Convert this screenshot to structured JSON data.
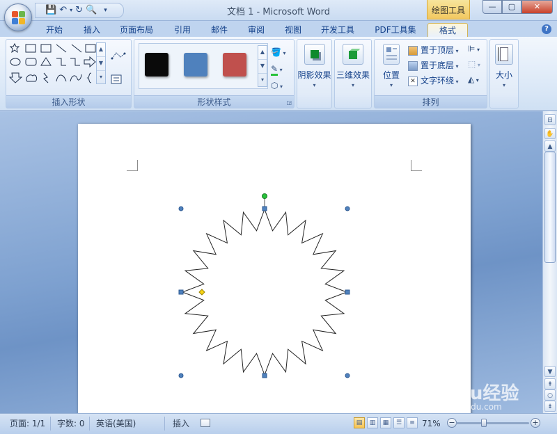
{
  "window": {
    "title": "文档 1 - Microsoft Word",
    "contextual_title": "绘图工具"
  },
  "tabs": [
    "开始",
    "插入",
    "页面布局",
    "引用",
    "邮件",
    "审阅",
    "视图",
    "开发工具",
    "PDF工具集",
    "格式"
  ],
  "active_tab": "格式",
  "ribbon": {
    "group_insert_shapes": "插入形状",
    "group_shape_styles": "形状样式",
    "group_arrange": "排列",
    "shadow_effects": "阴影效果",
    "threed_effects": "三维效果",
    "position": "位置",
    "bring_to_front": "置于顶层",
    "send_to_back": "置于底层",
    "text_wrap": "文字环绕",
    "size": "大小",
    "style_colors": [
      "#0a0a0a",
      "#4f81bd",
      "#c0504d"
    ]
  },
  "statusbar": {
    "page": "页面: 1/1",
    "words": "字数: 0",
    "language": "英语(美国)",
    "mode": "插入",
    "zoom": "71%"
  },
  "watermark": {
    "brand": "Baidu经验",
    "url": "jingyan.baidu.com"
  },
  "document": {
    "shape": "24-point star"
  },
  "colors": {
    "accent": "#15428b",
    "handle": "#4f81bd",
    "rotation_handle": "#27c23a",
    "adjust_handle": "#f7d416"
  }
}
